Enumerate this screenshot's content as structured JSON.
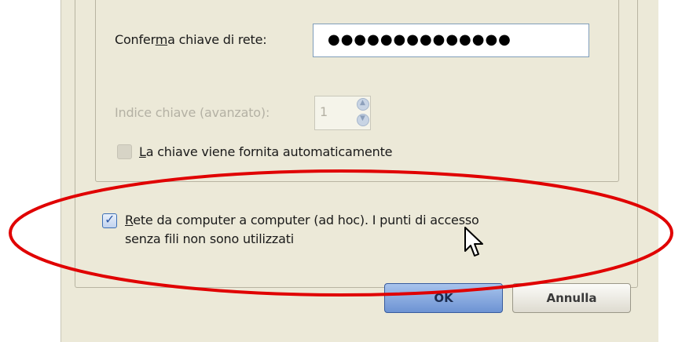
{
  "network": {
    "confirm_key_label_pre": "Confer",
    "confirm_key_label_ul": "m",
    "confirm_key_label_post": "a chiave di rete:",
    "confirm_key_value": "●●●●●●●●●●●●●●",
    "key_index_label": "Indice chiave (avanzato):",
    "key_index_value": "1",
    "auto_key_ul": "L",
    "auto_key_label": "a chiave viene fornita automaticamente",
    "adhoc_ul": "R",
    "adhoc_line1": "ete da computer a computer (ad hoc). I punti di accesso",
    "adhoc_line2": "senza fili non sono utilizzati",
    "adhoc_checked": true
  },
  "buttons": {
    "ok_label": "OK",
    "cancel_label": "Annulla"
  },
  "colors": {
    "annotation": "#e00000",
    "dialog_bg": "#ece9d8"
  },
  "icons": {
    "cursor": "arrow-cursor-icon",
    "spin_up": "spin-up-icon",
    "spin_down": "spin-down-icon",
    "check": "checkmark-icon"
  }
}
